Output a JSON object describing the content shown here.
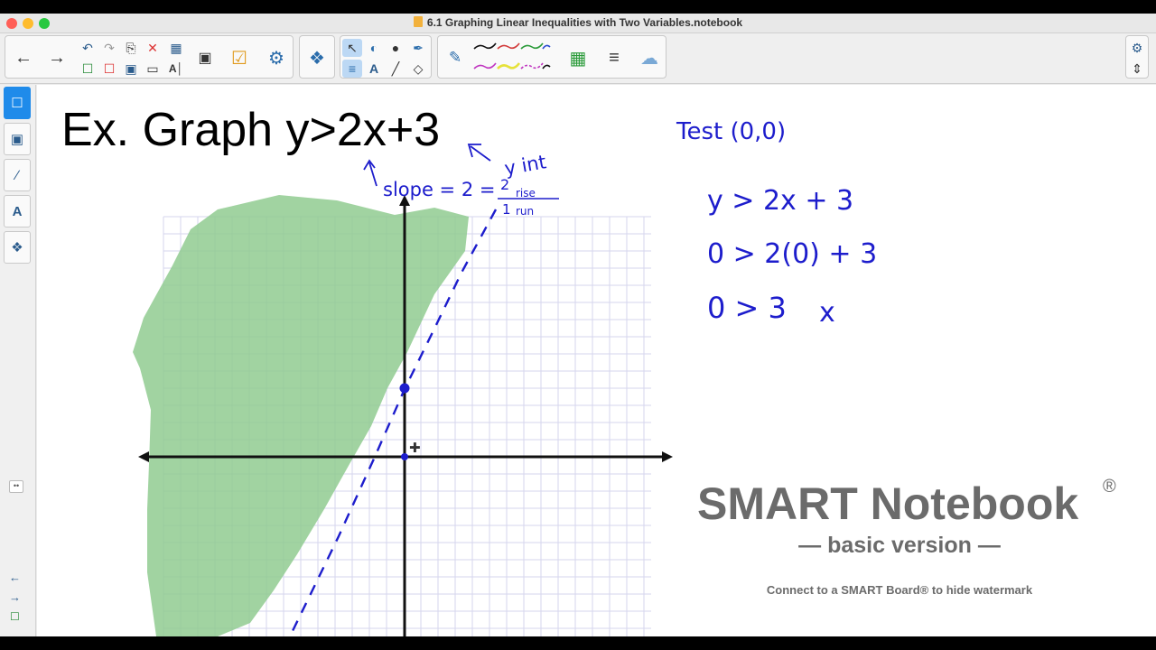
{
  "window": {
    "title": "6.1 Graphing Linear Inequalities with Two Variables.notebook"
  },
  "toolbar": {
    "icons": [
      "back-arrow",
      "forward-arrow",
      "undo",
      "redo",
      "paste",
      "delete",
      "table",
      "screen-shade",
      "check-box",
      "activity",
      "add-on",
      "select",
      "shapes",
      "fill",
      "eraser",
      "text",
      "line",
      "pen",
      "line-styles",
      "color-palette",
      "line-width",
      "properties",
      "settings",
      "expand"
    ]
  },
  "sidebar": {
    "tabs": [
      "page-sorter",
      "gallery",
      "attachments",
      "properties",
      "add-ons"
    ]
  },
  "page": {
    "heading": "Ex. Graph y>2x+3",
    "handwriting": {
      "slope_note": "slope = 2 = 2 rise / 1 run",
      "slope_parts": [
        "slope = 2 = ",
        "2",
        "rise",
        "1",
        "run"
      ],
      "yint_note": "y int",
      "test_label": "Test (0,0)",
      "steps": [
        "y > 2x + 3",
        "0 > 2(0) + 3",
        "0 > 3"
      ],
      "verdict": "x"
    }
  },
  "watermark": {
    "title": "SMART Notebook",
    "registered": "®",
    "subtitle": "— basic version —",
    "note": "Connect to a SMART Board® to hide watermark"
  },
  "colors": {
    "ink": "#1d1dcc",
    "shade": "#8cc98c",
    "grid": "#d6d6ee",
    "selected": "#1f8bea"
  }
}
